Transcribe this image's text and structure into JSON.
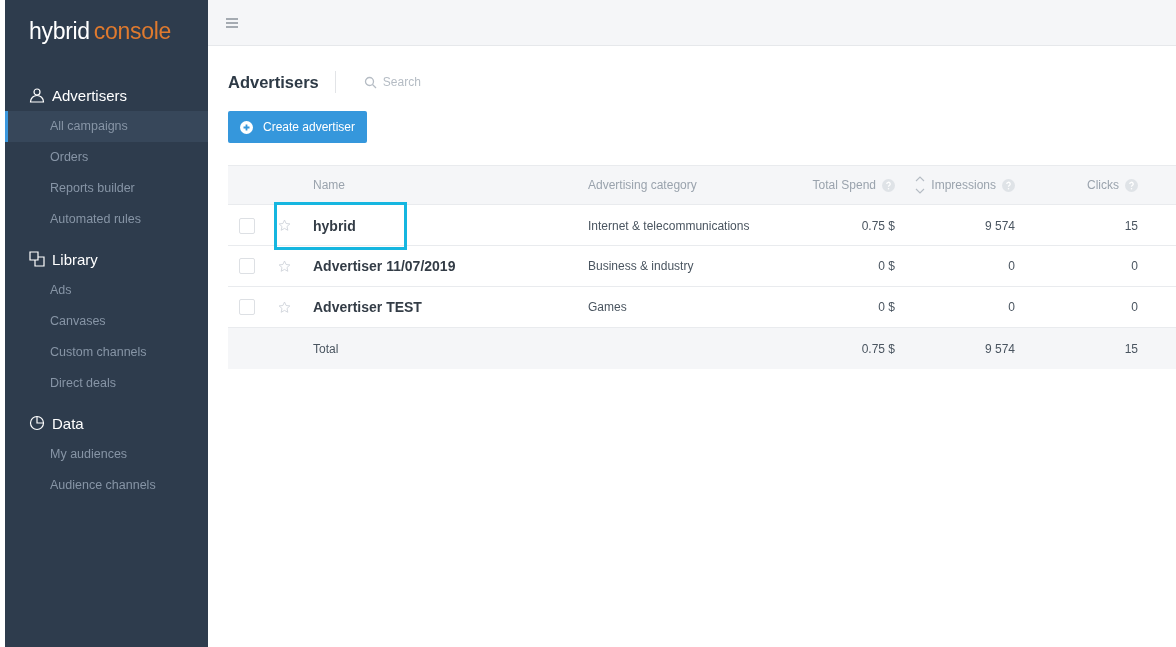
{
  "logo": {
    "first": "hybrid",
    "second": "console"
  },
  "sidebar": {
    "sections": [
      {
        "title": "Advertisers",
        "items": [
          {
            "label": "All campaigns",
            "selected": true
          },
          {
            "label": "Orders",
            "selected": false
          },
          {
            "label": "Reports builder",
            "selected": false
          },
          {
            "label": "Automated rules",
            "selected": false
          }
        ]
      },
      {
        "title": "Library",
        "items": [
          {
            "label": "Ads",
            "selected": false
          },
          {
            "label": "Canvases",
            "selected": false
          },
          {
            "label": "Custom channels",
            "selected": false
          },
          {
            "label": "Direct deals",
            "selected": false
          }
        ]
      },
      {
        "title": "Data",
        "items": [
          {
            "label": "My audiences",
            "selected": false
          },
          {
            "label": "Audience channels",
            "selected": false
          }
        ]
      }
    ]
  },
  "page": {
    "title": "Advertisers",
    "search": {
      "placeholder": "Search"
    },
    "create_button": "Create advertiser"
  },
  "table": {
    "columns": [
      {
        "label": "Name",
        "help": false,
        "sortable": false
      },
      {
        "label": "Advertising category",
        "help": false,
        "sortable": false
      },
      {
        "label": "Total Spend",
        "help": true,
        "sortable": false
      },
      {
        "label": "Impressions",
        "help": true,
        "sortable": true
      },
      {
        "label": "Clicks",
        "help": true,
        "sortable": false
      }
    ],
    "rows": [
      {
        "name": "hybrid",
        "category": "Internet & telecommunications",
        "spend": "0.75 $",
        "impressions": "9 574",
        "clicks": "15",
        "checked": false,
        "starred": false,
        "highlighted": true
      },
      {
        "name": "Advertiser 11/07/2019",
        "category": "Business & industry",
        "spend": "0 $",
        "impressions": "0",
        "clicks": "0",
        "checked": false,
        "starred": false,
        "highlighted": false
      },
      {
        "name": "Advertiser TEST",
        "category": "Games",
        "spend": "0 $",
        "impressions": "0",
        "clicks": "0",
        "checked": false,
        "starred": false,
        "highlighted": false
      }
    ],
    "total": {
      "label": "Total",
      "spend": "0.75 $",
      "impressions": "9 574",
      "clicks": "15"
    }
  }
}
